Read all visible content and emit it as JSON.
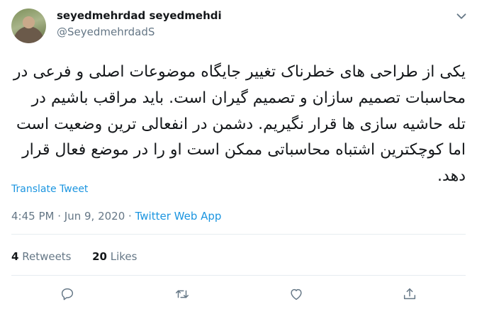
{
  "user": {
    "display_name": "seyedmehrdad seyedmehdi",
    "handle": "@SeyedmehrdadS"
  },
  "tweet": {
    "text": "یکی از طراحی های خطرناک تغییر جایگاه موضوعات اصلی و فرعی در محاسبات تصمیم سازان و تصمیم گیران است. باید مراقب باشیم در تله حاشیه سازی ها قرار نگیریم. دشمن در انفعالی ترین وضعیت است اما کوچکترین اشتباه محاسباتی ممکن است او را در موضع فعال قرار دهد."
  },
  "translate_label": "Translate Tweet",
  "meta": {
    "time": "4:45 PM",
    "sep1": "·",
    "date": "Jun 9, 2020",
    "sep2": "·",
    "source": "Twitter Web App"
  },
  "stats": {
    "retweets_count": "4",
    "retweets_label": "Retweets",
    "likes_count": "20",
    "likes_label": "Likes"
  },
  "actions": [
    "reply-icon",
    "retweet-icon",
    "like-icon",
    "share-icon"
  ],
  "colors": {
    "accent": "#1b95e0",
    "text": "#14171a",
    "secondary": "#657786",
    "divider": "#e6ecf0"
  }
}
